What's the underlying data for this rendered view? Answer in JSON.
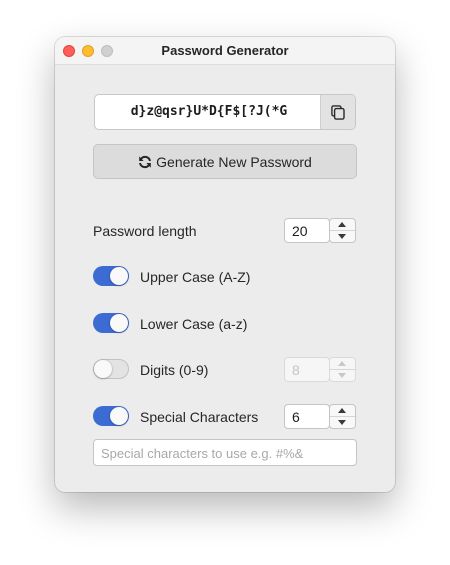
{
  "window": {
    "title": "Password Generator"
  },
  "password": {
    "value": "d}z@qsr}U*D{F$[?J(*G"
  },
  "icons": {
    "copy": "copy-icon",
    "refresh": "refresh-icon"
  },
  "generate": {
    "label": "Generate New Password"
  },
  "length": {
    "label": "Password length",
    "value": "20"
  },
  "options": [
    {
      "label": "Upper Case (A-Z)",
      "enabled": true
    },
    {
      "label": "Lower Case (a-z)",
      "enabled": true
    },
    {
      "label": "Digits (0-9)",
      "enabled": false,
      "count": "8"
    },
    {
      "label": "Special Characters",
      "enabled": true,
      "count": "6"
    }
  ],
  "special_chars": {
    "value": "",
    "placeholder": "Special characters to use e.g. #%&"
  },
  "colors": {
    "toggle_on": "#3c6bd4",
    "close": "#fe5f57",
    "minimize": "#febc2e"
  }
}
